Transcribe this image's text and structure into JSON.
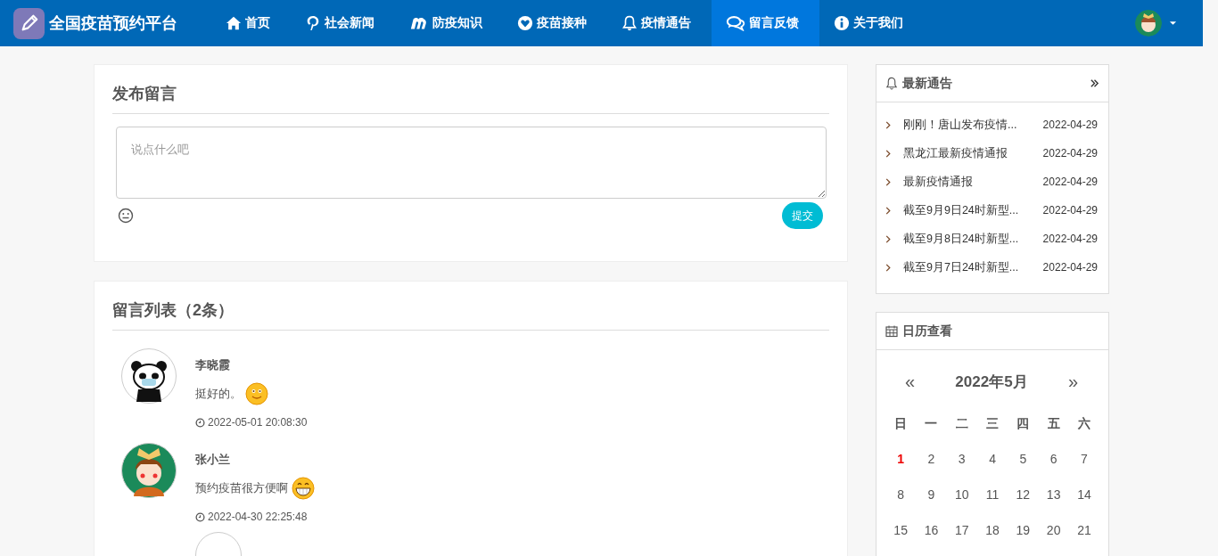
{
  "brand": {
    "title": "全国疫苗预约平台"
  },
  "nav": [
    {
      "label": "首页",
      "selected": false
    },
    {
      "label": "社会新闻",
      "selected": false
    },
    {
      "label": "防疫知识",
      "selected": false
    },
    {
      "label": "疫苗接种",
      "selected": false
    },
    {
      "label": "疫情通告",
      "selected": false
    },
    {
      "label": "留言反馈",
      "selected": true
    },
    {
      "label": "关于我们",
      "selected": false
    }
  ],
  "post": {
    "title": "发布留言",
    "placeholder": "说点什么吧",
    "submit": "提交"
  },
  "comments": {
    "title": "留言列表（2条）",
    "items": [
      {
        "name": "李晓霞",
        "text": "挺好的。",
        "time": "2022-05-01 20:08:30"
      },
      {
        "name": "张小兰",
        "text": "预约疫苗很方便啊",
        "time": "2022-04-30 22:25:48"
      }
    ]
  },
  "notices": {
    "title": "最新通告",
    "items": [
      {
        "title": "刚刚！唐山发布疫情...",
        "date": "2022-04-29"
      },
      {
        "title": "黑龙江最新疫情通报",
        "date": "2022-04-29"
      },
      {
        "title": "最新疫情通报",
        "date": "2022-04-29"
      },
      {
        "title": "截至9月9日24时新型...",
        "date": "2022-04-29"
      },
      {
        "title": "截至9月8日24时新型...",
        "date": "2022-04-29"
      },
      {
        "title": "截至9月7日24时新型...",
        "date": "2022-04-29"
      }
    ]
  },
  "calendar": {
    "title": "日历查看",
    "prev": "«",
    "month": "2022年5月",
    "next": "»",
    "weekdays": [
      "日",
      "一",
      "二",
      "三",
      "四",
      "五",
      "六"
    ],
    "weeks": [
      [
        {
          "day": "1",
          "today": true
        },
        {
          "day": "2",
          "today": false
        },
        {
          "day": "3",
          "today": false
        },
        {
          "day": "4",
          "today": false
        },
        {
          "day": "5",
          "today": false
        },
        {
          "day": "6",
          "today": false
        },
        {
          "day": "7",
          "today": false
        }
      ],
      [
        {
          "day": "8",
          "today": false
        },
        {
          "day": "9",
          "today": false
        },
        {
          "day": "10",
          "today": false
        },
        {
          "day": "11",
          "today": false
        },
        {
          "day": "12",
          "today": false
        },
        {
          "day": "13",
          "today": false
        },
        {
          "day": "14",
          "today": false
        }
      ],
      [
        {
          "day": "15",
          "today": false
        },
        {
          "day": "16",
          "today": false
        },
        {
          "day": "17",
          "today": false
        },
        {
          "day": "18",
          "today": false
        },
        {
          "day": "19",
          "today": false
        },
        {
          "day": "20",
          "today": false
        },
        {
          "day": "21",
          "today": false
        }
      ]
    ]
  }
}
